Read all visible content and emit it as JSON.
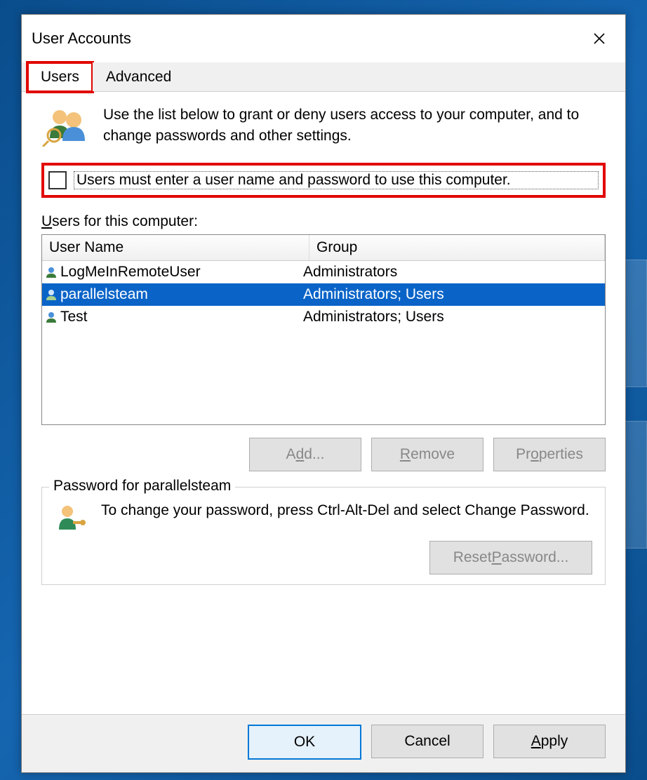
{
  "window": {
    "title": "User Accounts"
  },
  "tabs": [
    {
      "label": "Users",
      "active": true
    },
    {
      "label": "Advanced",
      "active": false
    }
  ],
  "intro_text": "Use the list below to grant or deny users access to your computer, and to change passwords and other settings.",
  "checkbox": {
    "checked": false,
    "label": "Users must enter a user name and password to use this computer."
  },
  "list_label_prefix": "U",
  "list_label_rest": "sers for this computer:",
  "columns": {
    "name": "User Name",
    "group": "Group"
  },
  "users": [
    {
      "name": "LogMeInRemoteUser",
      "group": "Administrators",
      "selected": false
    },
    {
      "name": "parallelsteam",
      "group": "Administrators; Users",
      "selected": true
    },
    {
      "name": "Test",
      "group": "Administrators; Users",
      "selected": false
    }
  ],
  "buttons": {
    "add_prefix": "A",
    "add_underline": "d",
    "add_suffix": "d...",
    "remove_prefix": "",
    "remove_underline": "R",
    "remove_suffix": "emove",
    "properties_prefix": "Pr",
    "properties_underline": "o",
    "properties_suffix": "perties"
  },
  "password_group": {
    "title": "Password for parallelsteam",
    "text": "To change your password, press Ctrl-Alt-Del and select Change Password.",
    "reset_prefix": "Reset ",
    "reset_underline": "P",
    "reset_suffix": "assword..."
  },
  "dialog_buttons": {
    "ok": "OK",
    "cancel": "Cancel",
    "apply_underline": "A",
    "apply_suffix": "pply"
  }
}
